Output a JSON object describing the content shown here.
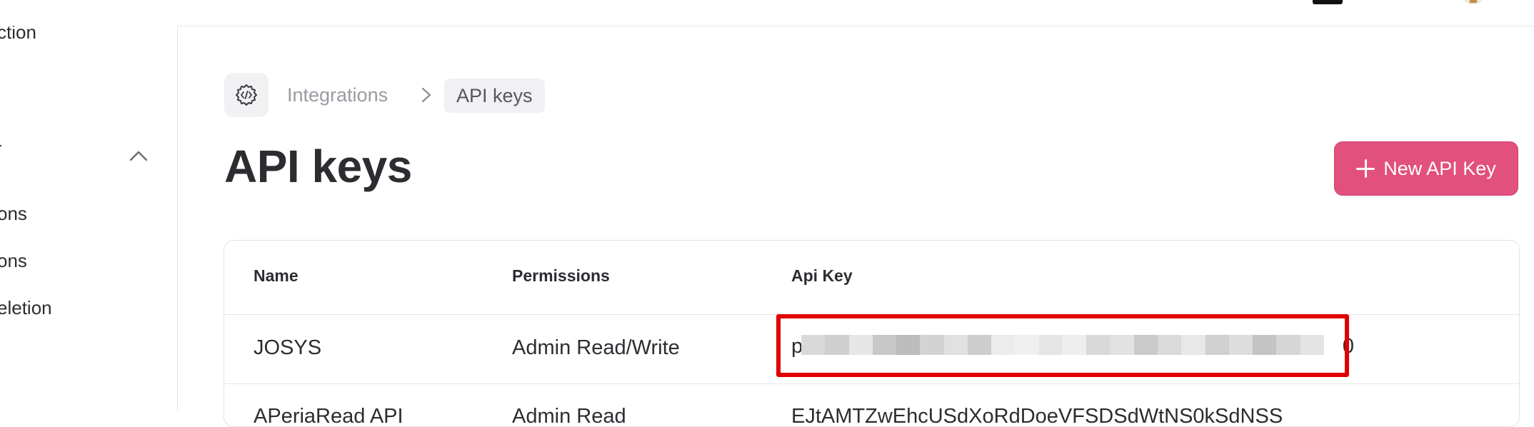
{
  "sidebar": {
    "items": [
      {
        "label": "ction"
      },
      {
        "label": "ons"
      },
      {
        "label": "ons"
      },
      {
        "label": "eletion"
      }
    ]
  },
  "breadcrumb": {
    "parent": "Integrations",
    "current": "API keys"
  },
  "page": {
    "title": "API keys",
    "new_button": "New API Key"
  },
  "table": {
    "headers": [
      "Name",
      "Permissions",
      "Api Key"
    ],
    "rows": [
      {
        "name": "JOSYS",
        "permissions": "Admin Read/Write",
        "key_start": "p",
        "key_end": "0"
      },
      {
        "name": "APeriaRead API",
        "permissions": "Admin Read",
        "key_partial": "EJtAMTZwEhcUSdXoRdDoeVFSDSdWtNS0kSdNSS"
      }
    ]
  },
  "colors": {
    "accent": "#e2507e",
    "highlight": "#e00000"
  }
}
